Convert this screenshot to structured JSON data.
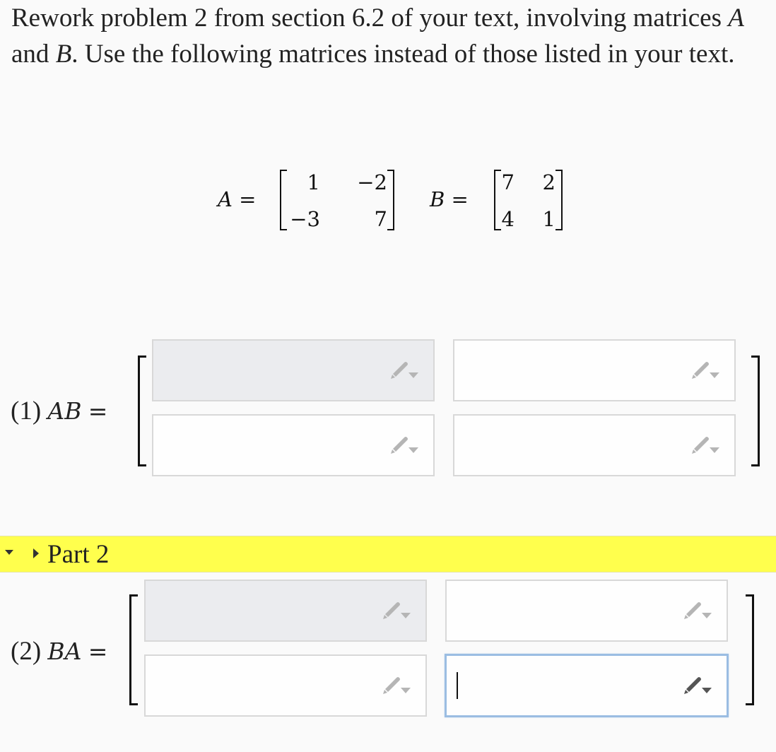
{
  "intro": {
    "text_1": "Rework problem 2 from section 6.2 of your text, involving matrices ",
    "var_a": "A",
    "text_2": " and ",
    "var_b": "B",
    "text_3": ". Use the following matrices instead of those listed in your text."
  },
  "given": {
    "a_label": "A",
    "b_label": "B",
    "equals": "=",
    "matrix_a": [
      [
        "1",
        "−2"
      ],
      [
        "−3",
        "7"
      ]
    ],
    "matrix_b": [
      [
        "7",
        "2"
      ],
      [
        "4",
        "1"
      ]
    ]
  },
  "question_1": {
    "number": "(1)",
    "expression": "AB",
    "equals": "=",
    "cells": [
      [
        "",
        ""
      ],
      [
        "",
        ""
      ]
    ]
  },
  "part_2": {
    "label": "Part 2",
    "highlight_color": "#ffff4d"
  },
  "question_2": {
    "number": "(2)",
    "expression": "BA",
    "equals": "=",
    "cells": [
      [
        "",
        ""
      ],
      [
        "",
        ""
      ]
    ]
  },
  "icons": {
    "input_icon": "pencil-dropdown-icon",
    "part_toggle": "triangle-down-icon",
    "part_expand": "triangle-right-icon"
  },
  "colors": {
    "filled_cell": "#ebecef",
    "active_border": "#9bbde2",
    "pencil": "#b5b5b5",
    "pencil_active": "#555555"
  }
}
